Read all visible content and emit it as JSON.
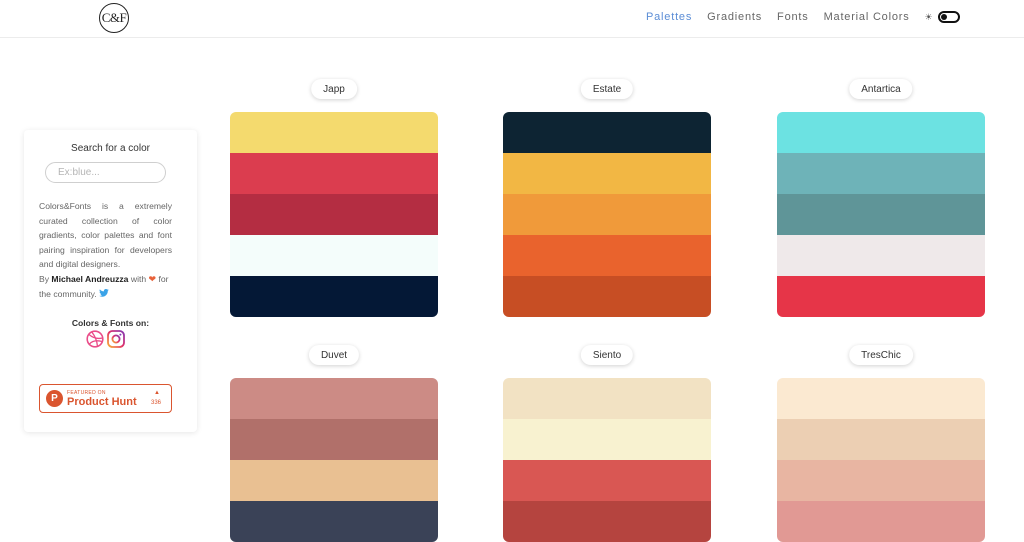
{
  "header": {
    "logo": "C&F",
    "nav": [
      {
        "label": "Palettes",
        "active": true
      },
      {
        "label": "Gradients",
        "active": false
      },
      {
        "label": "Fonts",
        "active": false
      },
      {
        "label": "Material Colors",
        "active": false
      }
    ],
    "theme_toggle_icon": "sun-icon"
  },
  "sidebar": {
    "search_title": "Search for a color",
    "search_placeholder": "Ex:blue...",
    "description": "Colors&Fonts is a extremely curated collection of color gradients, color palettes and font pairing inspiration for developers and digital designers.",
    "by_prefix": "By",
    "author": "Michael Andreuzza",
    "with": "with",
    "for_community": "for the community.",
    "social_title": "Colors & Fonts on:",
    "product_hunt": {
      "featured": "FEATURED ON",
      "name": "Product Hunt",
      "count": "336"
    }
  },
  "palettes": [
    {
      "name": "Japp",
      "colors": [
        "#f4da6e",
        "#db3d4f",
        "#b42d42",
        "#f4fdfb",
        "#041836"
      ]
    },
    {
      "name": "Estate",
      "colors": [
        "#0d2433",
        "#f2b744",
        "#f09a3a",
        "#e9632d",
        "#c74e24"
      ]
    },
    {
      "name": "Antartica",
      "colors": [
        "#6ce2e2",
        "#6eb3b8",
        "#5f9598",
        "#efe9ea",
        "#e63548"
      ]
    },
    {
      "name": "Duvet",
      "colors": [
        "#cc8b85",
        "#b1706a",
        "#e9c092",
        "#3a4257"
      ]
    },
    {
      "name": "Siento",
      "colors": [
        "#f2e2c3",
        "#f8f2d0",
        "#d95753",
        "#b5443f"
      ]
    },
    {
      "name": "TresChic",
      "colors": [
        "#fbe9d1",
        "#eccfb3",
        "#e8b5a2",
        "#e19994"
      ]
    }
  ]
}
